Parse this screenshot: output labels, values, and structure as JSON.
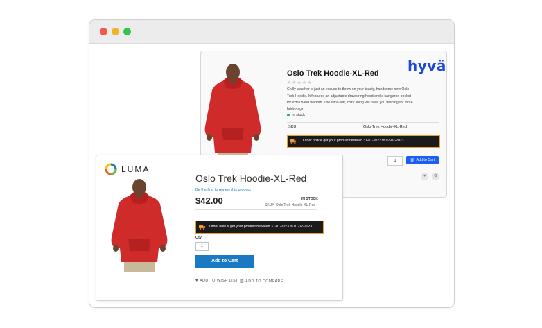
{
  "hyva": {
    "logo_text": "hyvä",
    "title": "Oslo Trek Hoodie-XL-Red",
    "rating_stars": "★★★★★",
    "description": "Chilly weather is just an excuse to throw on your toasty, handsome new Oslo Trek Hoodie. It features an adjustable drawstring hood and a kangaroo pocket for extra hand warmth. The ultra-soft, cozy lining will have you wishing for more brisk days.",
    "stock_status": "In stock",
    "sku_label": "SKU",
    "sku_value": "Oslo Trek Hoodie-XL-Red",
    "delivery_banner": "Order now & get your product between 31-01-2023 to 07-02-2023",
    "qty_value": "1",
    "add_to_cart_label": "Add to Cart",
    "wishlist_icon": "heart-icon",
    "compare_icon": "compare-icon",
    "accent_color": "#1c5ff0"
  },
  "luma": {
    "logo_text": "LUMA",
    "title": "Oslo Trek Hoodie-XL-Red",
    "review_link": "Be the first to review this product",
    "price": "$42.00",
    "stock_status": "IN STOCK",
    "sku_label": "SKU#:",
    "sku_value": "Oslo Trek Hoodie-XL-Red",
    "delivery_banner": "Order now & get your product between 31-01-2023 to 07-02-2023",
    "qty_label": "Qty",
    "qty_value": "1",
    "add_to_cart_label": "Add to Cart",
    "wishlist_label": "ADD TO WISH LIST",
    "compare_label": "ADD TO COMPARE",
    "accent_color": "#1979c3"
  },
  "browser": {
    "window_controls": [
      "close",
      "minimize",
      "maximize"
    ]
  }
}
